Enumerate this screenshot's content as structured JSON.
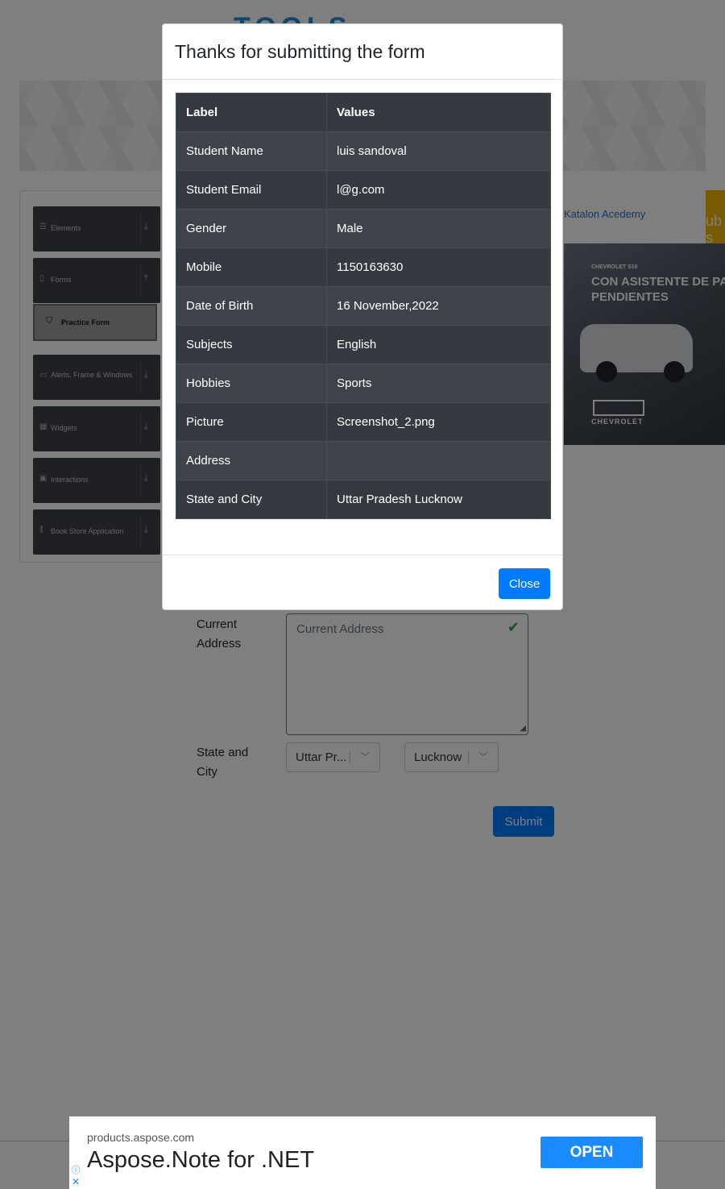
{
  "site": {
    "logo_text": "TOOLS"
  },
  "sidebar": {
    "groups": [
      {
        "label": "Elements",
        "icon": "list-icon",
        "arrow": "⤓"
      },
      {
        "label": "Forms",
        "icon": "doc-icon",
        "arrow": "⤒"
      },
      {
        "label": "Alerts, Frame & Windows",
        "icon": "window-icon",
        "arrow": "⤓"
      },
      {
        "label": "Widgets",
        "icon": "grid-icon",
        "arrow": "⤓"
      },
      {
        "label": "Interactions",
        "icon": "box-icon",
        "arrow": "⤓"
      },
      {
        "label": "Book Store Application",
        "icon": "books-icon",
        "arrow": "⤓"
      }
    ],
    "active_item": {
      "label": "Practice Form",
      "icon": "html5-icon"
    }
  },
  "ads": {
    "side_link": "Katalon Acedemy",
    "yellow_text": "ub s sa",
    "car": {
      "small": "CHEVROLET S10",
      "headline": "CON ASISTENTE DE PARTI PENDIENTES",
      "brand": "CHEVROLET"
    },
    "bottom": {
      "domain": "products.aspose.com",
      "title": "Aspose.Note for .NET",
      "open_label": "OPEN",
      "info_glyph": "ⓘ",
      "close_glyph": "✕"
    }
  },
  "form": {
    "current_address_label": "Current Address",
    "current_address_placeholder": "Current Address",
    "state_city_label": "State and City",
    "state_value": "Uttar Pr...",
    "city_value": "Lucknow",
    "submit_label": "Submit"
  },
  "modal": {
    "title": "Thanks for submitting the form",
    "headers": [
      "Label",
      "Values"
    ],
    "rows": [
      {
        "label": "Student Name",
        "value": "luis sandoval"
      },
      {
        "label": "Student Email",
        "value": "l@g.com"
      },
      {
        "label": "Gender",
        "value": "Male"
      },
      {
        "label": "Mobile",
        "value": "1150163630"
      },
      {
        "label": "Date of Birth",
        "value": "16 November,2022"
      },
      {
        "label": "Subjects",
        "value": "English"
      },
      {
        "label": "Hobbies",
        "value": "Sports"
      },
      {
        "label": "Picture",
        "value": "Screenshot_2.png"
      },
      {
        "label": "Address",
        "value": ""
      },
      {
        "label": "State and City",
        "value": "Uttar Pradesh Lucknow"
      }
    ],
    "close_label": "Close"
  },
  "colors": {
    "primary": "#007bff",
    "table_dark": "#343a40",
    "success": "#28a745"
  }
}
